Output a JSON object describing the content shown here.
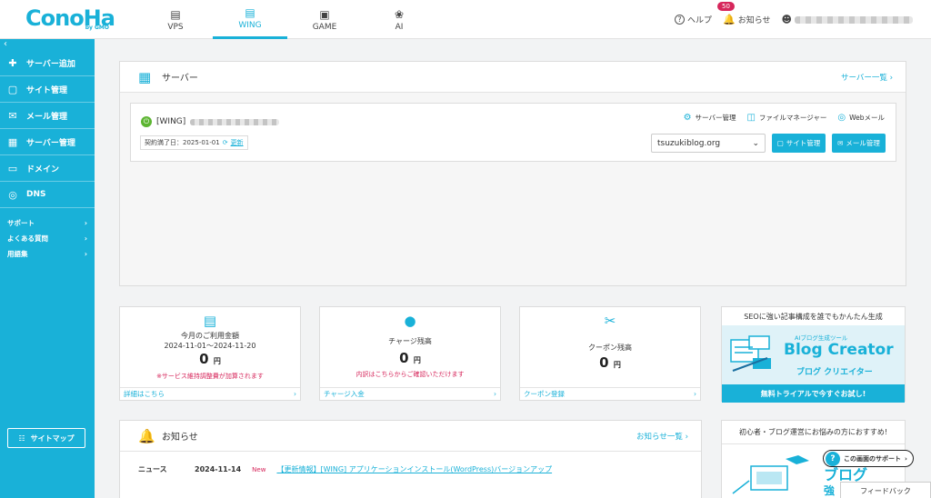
{
  "header": {
    "logo": "ConoHa",
    "logo_by": "by GMO",
    "tabs": [
      {
        "label": "VPS",
        "icon": "server-icon"
      },
      {
        "label": "WING",
        "icon": "wing-server-icon"
      },
      {
        "label": "GAME",
        "icon": "gamepad-icon"
      },
      {
        "label": "AI",
        "icon": "ai-brain-icon"
      }
    ],
    "active_tab": "WING",
    "help_label": "ヘルプ",
    "notices_label": "お知らせ",
    "notices_count": "50"
  },
  "sidebar": {
    "collapse": "‹",
    "items": [
      {
        "label": "サーバー追加",
        "icon": "plus-icon"
      },
      {
        "label": "サイト管理",
        "icon": "window-icon"
      },
      {
        "label": "メール管理",
        "icon": "mail-icon"
      },
      {
        "label": "サーバー管理",
        "icon": "server-icon"
      },
      {
        "label": "ドメイン",
        "icon": "domain-icon"
      },
      {
        "label": "DNS",
        "icon": "globe-icon"
      }
    ],
    "links": [
      {
        "label": "サポート"
      },
      {
        "label": "よくある質問"
      },
      {
        "label": "用語集"
      }
    ],
    "sitemap": "サイトマップ"
  },
  "server_panel": {
    "title": "サーバー",
    "more": "サーバー一覧",
    "server_prefix": "[WING]",
    "contract": "契約満了日：2025-01-01",
    "renew": "更新",
    "tools": [
      "サーバー管理",
      "ファイルマネージャー",
      "Webメール"
    ],
    "domain": "tsuzukiblog.org",
    "site_btn": "サイト管理",
    "mail_btn": "メール管理"
  },
  "stats": [
    {
      "label": "今月のご利用金額",
      "range": "2024-11-01〜2024-11-20",
      "value": "0",
      "unit": "円",
      "note": "※サービス維持調整費が加算されます",
      "footer": "詳細はこちら"
    },
    {
      "label": "チャージ残高",
      "value": "0",
      "unit": "円",
      "note": "内訳はこちらからご確認いただけます",
      "footer": "チャージ入金"
    },
    {
      "label": "クーポン残高",
      "value": "0",
      "unit": "円",
      "footer": "クーポン登録"
    }
  ],
  "ad": {
    "top": "SEOに強い記事構成を誰でもかんたん生成",
    "sub": "AIブログ生成ツール",
    "brand": "Blog Creator",
    "jp": "ブログ クリエイター",
    "cta": "無料トライアルで今すぐお試し!"
  },
  "news": {
    "title": "お知らせ",
    "more": "お知らせ一覧",
    "rows": [
      {
        "category": "ニュース",
        "date": "2024-11-14",
        "new": "New",
        "text": "【更新情報】[WING] アプリケーションインストール(WordPress)バージョンアップ"
      }
    ]
  },
  "ad2": {
    "top": "初心者・ブログ運営にお悩みの方におすすめ!",
    "blog": "ブログ",
    "blog2": "強"
  },
  "help_pill": "この画面のサポート",
  "feedback": "フィードバック",
  "colors": {
    "accent": "#19b1d8",
    "alert": "#d6265b",
    "power": "#5cb531"
  }
}
